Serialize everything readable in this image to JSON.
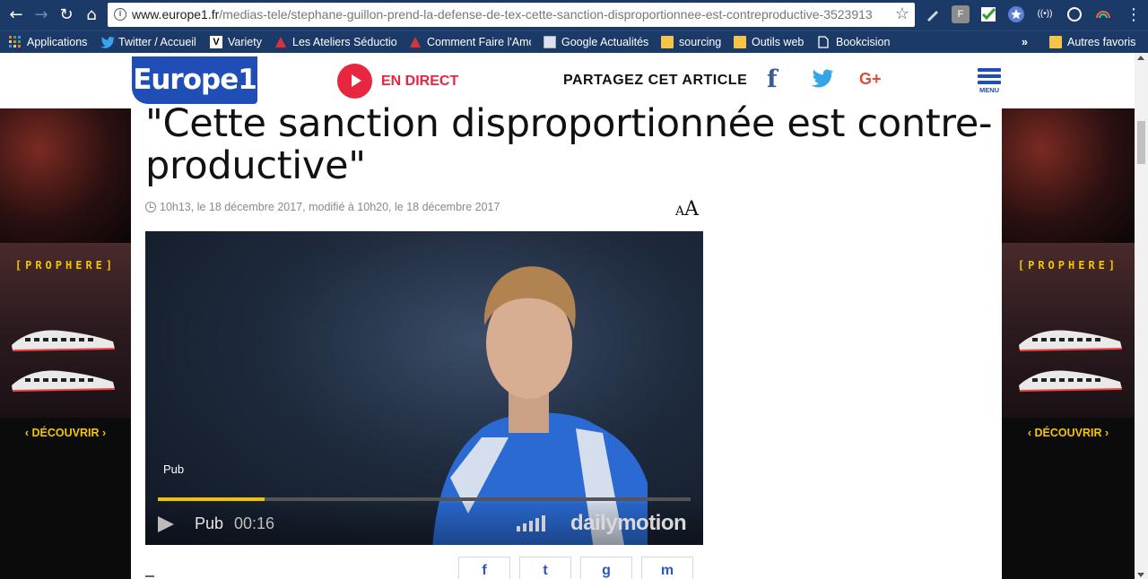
{
  "browser": {
    "url_host": "www.europe1.fr",
    "url_path": "/medias-tele/stephane-guillon-prend-la-defense-de-tex-cette-sanction-disproportionnee-est-contreproductive-3523913",
    "bookmarks": [
      {
        "label": "Applications",
        "icon": "apps-grid-icon"
      },
      {
        "label": "Twitter / Accueil",
        "icon": "twitter-bird-icon"
      },
      {
        "label": "Variety",
        "icon": "variety-logo-icon"
      },
      {
        "label": "Les Ateliers Séductior",
        "icon": "red-logo-icon"
      },
      {
        "label": "Comment Faire l'Amc",
        "icon": "red-logo-icon"
      },
      {
        "label": "Google Actualités",
        "icon": "news-icon"
      },
      {
        "label": "sourcing",
        "icon": "folder-icon"
      },
      {
        "label": "Outils web",
        "icon": "folder-icon"
      },
      {
        "label": "Bookcision",
        "icon": "page-icon"
      }
    ],
    "overflow_label": "»",
    "other_bookmarks": "Autres favoris",
    "ext_f_label": "F"
  },
  "header": {
    "logo_text": "Europe1",
    "live_label": "EN DIRECT",
    "share_label": "PARTAGEZ CET ARTICLE",
    "facebook_glyph": "f",
    "googleplus_glyph": "G+",
    "menu_label": "MENU"
  },
  "ads": {
    "brand": "[PROPHERE]",
    "cta_left": "‹ DÉCOUVRIR ›",
    "cta_right": "‹ DÉCOUVRIR ›"
  },
  "article": {
    "title": "\"Cette sanction disproportionnée est contre-productive\"",
    "meta": "10h13, le 18 décembre 2017, modifié à 10h20, le 18 décembre 2017",
    "font_toggle_small": "A",
    "font_toggle_big": "A"
  },
  "video": {
    "overlay_pub": "Pub",
    "control_pub": "Pub",
    "time": "00:16",
    "progress_percent": 20,
    "brand": "dailymotion"
  },
  "share_buttons": [
    "f",
    "t",
    "g",
    "m"
  ],
  "colors": {
    "chrome": "#1c3a68",
    "brand_blue": "#1f4fb6",
    "live_red": "#e8263f",
    "ad_yellow": "#f2c600",
    "progress": "#f2c200"
  }
}
